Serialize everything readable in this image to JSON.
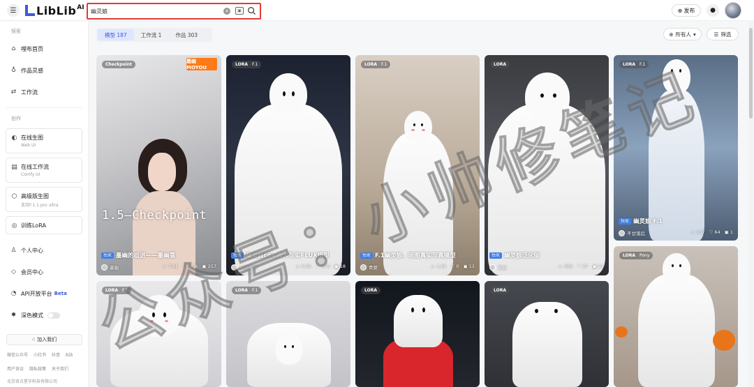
{
  "header": {
    "logo_text": "LibLib",
    "logo_suffix": "AI",
    "search_value": "幽灵娘",
    "publish_label": "发布"
  },
  "sidebar": {
    "section_explore": "探索",
    "section_create": "创作",
    "items": [
      {
        "label": "哩布首页"
      },
      {
        "label": "作品灵感"
      },
      {
        "label": "工作流"
      }
    ],
    "tools": [
      {
        "label": "在线生图",
        "sub": "Web UI"
      },
      {
        "label": "在线工作流",
        "sub": "Comfy UI"
      },
      {
        "label": "高级版生图",
        "sub": "支持F.1.1 pro ultra"
      },
      {
        "label": "训练LoRA",
        "sub": ""
      }
    ],
    "personal": "个人中心",
    "member": "会员中心",
    "api": "API开放平台",
    "api_badge": "Beta",
    "dark_mode": "深色模式",
    "join_label": "加入我们",
    "links_row1": [
      "微信公众号",
      "小红书",
      "抖音",
      "B站"
    ],
    "links_row2": [
      "用户协议",
      "隐私政策",
      "关于我们"
    ],
    "copyright": "北京奇点星宇科技有限公司"
  },
  "tabs": [
    {
      "label": "模型 187"
    },
    {
      "label": "工作流 1"
    },
    {
      "label": "作品 303"
    }
  ],
  "filters": {
    "owner": "所有人",
    "filter": "筛选"
  },
  "cards": [
    {
      "tag": "Checkpoint",
      "version": "",
      "badge": "独家",
      "title": "墨幽的组进——墨幽蔻",
      "author": "墨幽",
      "s1": "7.8k",
      "s2": "4.3k",
      "s3": "257",
      "bigtext": "1.5—Checkpoint",
      "brand": "墨幽 MOYOU"
    },
    {
      "tag": "LORA",
      "version": "F.1",
      "badge": "独家",
      "title": "幽灵娘cos 真人写实FLUX模型",
      "author": "AI虚拟姬",
      "s1": "6.9k",
      "s2": "170",
      "s3": "18"
    },
    {
      "tag": "LORA",
      "version": "F.1",
      "badge": "独家",
      "title": "F.1幽灵娘、网图真实写真模型",
      "author": "青葵",
      "s1": "1.8k",
      "s2": "0",
      "s3": "11"
    },
    {
      "tag": "LORA",
      "version": "",
      "badge": "独家",
      "title": "幽灵娘泛化版",
      "author": "无念",
      "s1": "386",
      "s2": "67",
      "s3": "21"
    },
    {
      "tag": "LORA",
      "version": "F.1",
      "badge": "独家",
      "title": "幽灵娘 F.1",
      "author": "不甘落后",
      "s1": "337",
      "s2": "64",
      "s3": "1"
    },
    {
      "tag": "LORA",
      "version": "F.1"
    },
    {
      "tag": "LORA",
      "version": "F.1"
    },
    {
      "tag": "LORA",
      "version": ""
    },
    {
      "tag": "LORA",
      "version": ""
    },
    {
      "tag": "LORA",
      "version": "Pony"
    }
  ],
  "watermark": "公众号：小帅修笔记",
  "colors": {
    "accent": "#3b5bdb",
    "search_border": "#e53935",
    "exclusive": "#3b82f6"
  }
}
